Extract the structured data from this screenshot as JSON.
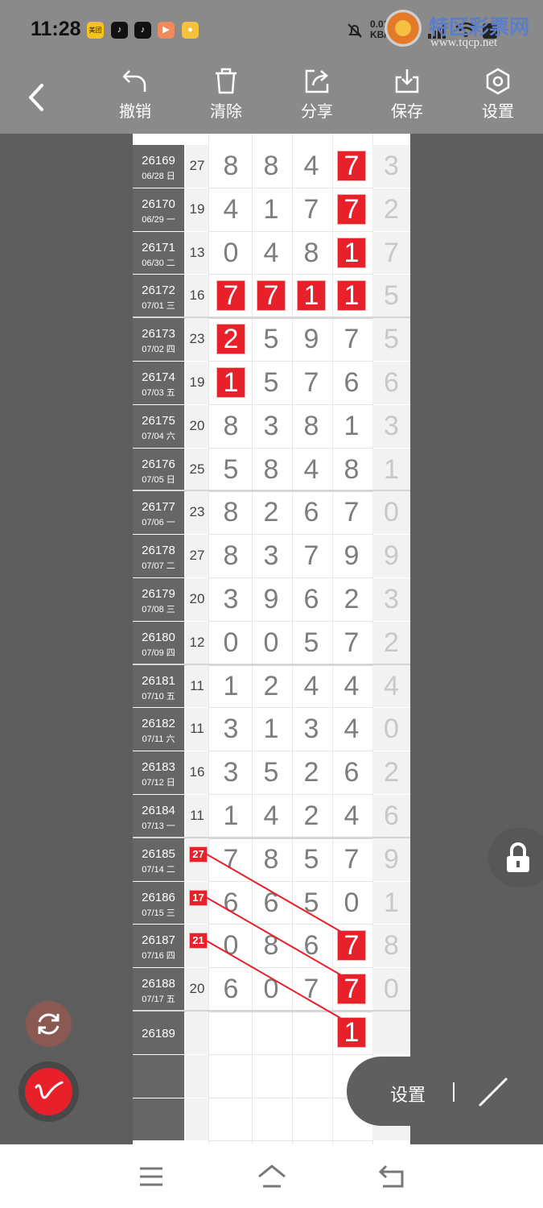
{
  "status_bar": {
    "time": "11:28",
    "net_speed_value": "0.01",
    "net_speed_unit": "KB/s",
    "app_badges": [
      "美团",
      "tiktok",
      "tiktok",
      "video",
      "app"
    ],
    "icons": [
      "bell-off-icon",
      "5g-signal-icon",
      "wifi-icon",
      "battery-icon"
    ]
  },
  "watermark": {
    "title": "特区彩票网",
    "url": "www.tqcp.net"
  },
  "toolbar": {
    "undo_label": "撤销",
    "clear_label": "清除",
    "share_label": "分享",
    "save_label": "保存",
    "settings_label": "设置"
  },
  "rows": [
    {
      "period": "26169",
      "date": "06/28 日",
      "sum": "27",
      "digits": [
        "8",
        "8",
        "4",
        "7"
      ],
      "hl": [
        3
      ],
      "extra": "3"
    },
    {
      "period": "26170",
      "date": "06/29 一",
      "sum": "19",
      "digits": [
        "4",
        "1",
        "7",
        "7"
      ],
      "hl": [
        3
      ],
      "extra": "2"
    },
    {
      "period": "26171",
      "date": "06/30 二",
      "sum": "13",
      "digits": [
        "0",
        "4",
        "8",
        "1"
      ],
      "hl": [
        3
      ],
      "extra": "7"
    },
    {
      "period": "26172",
      "date": "07/01 三",
      "sum": "16",
      "digits": [
        "7",
        "7",
        "1",
        "1"
      ],
      "hl": [
        0,
        1,
        2,
        3
      ],
      "extra": "5"
    },
    {
      "period": "26173",
      "date": "07/02 四",
      "sum": "23",
      "digits": [
        "2",
        "5",
        "9",
        "7"
      ],
      "hl": [
        0
      ],
      "extra": "5"
    },
    {
      "period": "26174",
      "date": "07/03 五",
      "sum": "19",
      "digits": [
        "1",
        "5",
        "7",
        "6"
      ],
      "hl": [
        0
      ],
      "extra": "6"
    },
    {
      "period": "26175",
      "date": "07/04 六",
      "sum": "20",
      "digits": [
        "8",
        "3",
        "8",
        "1"
      ],
      "hl": [],
      "extra": "3"
    },
    {
      "period": "26176",
      "date": "07/05 日",
      "sum": "25",
      "digits": [
        "5",
        "8",
        "4",
        "8"
      ],
      "hl": [],
      "extra": "1"
    },
    {
      "period": "26177",
      "date": "07/06 一",
      "sum": "23",
      "digits": [
        "8",
        "2",
        "6",
        "7"
      ],
      "hl": [],
      "extra": "0"
    },
    {
      "period": "26178",
      "date": "07/07 二",
      "sum": "27",
      "digits": [
        "8",
        "3",
        "7",
        "9"
      ],
      "hl": [],
      "extra": "9"
    },
    {
      "period": "26179",
      "date": "07/08 三",
      "sum": "20",
      "digits": [
        "3",
        "9",
        "6",
        "2"
      ],
      "hl": [],
      "extra": "3"
    },
    {
      "period": "26180",
      "date": "07/09 四",
      "sum": "12",
      "digits": [
        "0",
        "0",
        "5",
        "7"
      ],
      "hl": [],
      "extra": "2"
    },
    {
      "period": "26181",
      "date": "07/10 五",
      "sum": "11",
      "digits": [
        "1",
        "2",
        "4",
        "4"
      ],
      "hl": [],
      "extra": "4"
    },
    {
      "period": "26182",
      "date": "07/11 六",
      "sum": "11",
      "digits": [
        "3",
        "1",
        "3",
        "4"
      ],
      "hl": [],
      "extra": "0"
    },
    {
      "period": "26183",
      "date": "07/12 日",
      "sum": "16",
      "digits": [
        "3",
        "5",
        "2",
        "6"
      ],
      "hl": [],
      "extra": "2"
    },
    {
      "period": "26184",
      "date": "07/13 一",
      "sum": "11",
      "digits": [
        "1",
        "4",
        "2",
        "4"
      ],
      "hl": [],
      "extra": "6"
    },
    {
      "period": "26185",
      "date": "07/14 二",
      "sum": "",
      "tag": "27",
      "digits": [
        "7",
        "8",
        "5",
        "7"
      ],
      "hl": [],
      "extra": "9"
    },
    {
      "period": "26186",
      "date": "07/15 三",
      "sum": "",
      "tag": "17",
      "digits": [
        "6",
        "6",
        "5",
        "0"
      ],
      "hl": [],
      "extra": "1"
    },
    {
      "period": "26187",
      "date": "07/16 四",
      "sum": "",
      "tag": "21",
      "digits": [
        "0",
        "8",
        "6",
        "7"
      ],
      "hl": [
        3
      ],
      "extra": "8"
    },
    {
      "period": "26188",
      "date": "07/17 五",
      "sum": "20",
      "digits": [
        "6",
        "0",
        "7",
        "7"
      ],
      "hl": [
        3
      ],
      "extra": "0"
    },
    {
      "period": "26189",
      "date": "",
      "sum": "",
      "digits": [
        "",
        "",
        "",
        "1"
      ],
      "hl": [
        3
      ],
      "extra": ""
    },
    {
      "period": "",
      "date": "",
      "sum": "",
      "digits": [
        "",
        "",
        "",
        ""
      ],
      "hl": [],
      "extra": ""
    },
    {
      "period": "",
      "date": "",
      "sum": "",
      "digits": [
        "",
        "",
        "",
        ""
      ],
      "hl": [],
      "extra": ""
    }
  ],
  "bottom_panel": {
    "settings_label": "设置"
  },
  "colors": {
    "highlight": "#e8202a",
    "toolbar_bg": "#8a8a8a",
    "period_bg": "#666666"
  }
}
